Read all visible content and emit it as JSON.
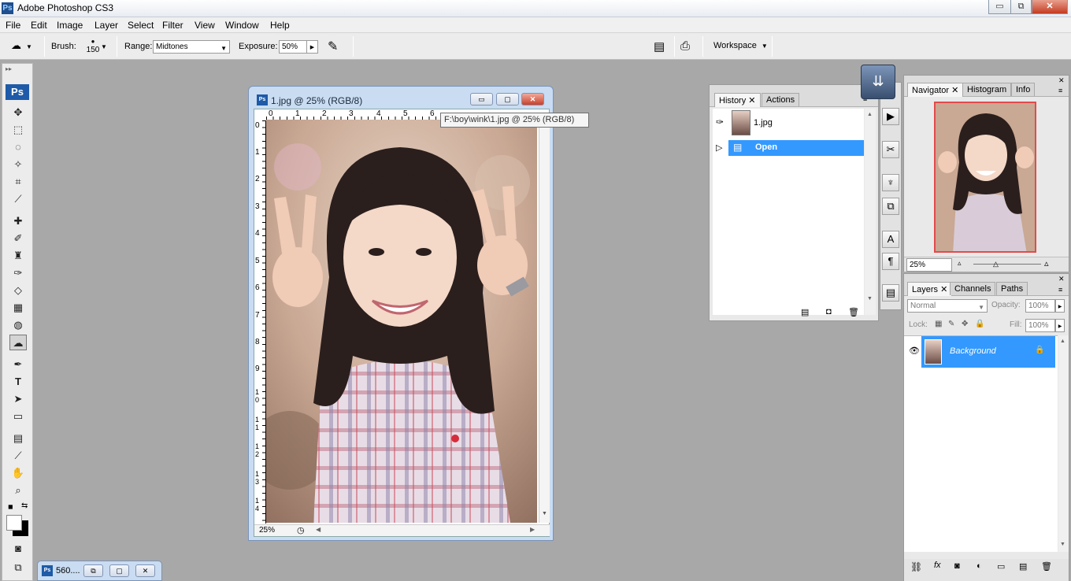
{
  "app": {
    "title": "Adobe Photoshop CS3",
    "badge": "Ps",
    "win_controls": {
      "minimize": "▭",
      "restore": "⧉",
      "close": "✕"
    }
  },
  "menu": [
    "File",
    "Edit",
    "Image",
    "Layer",
    "Select",
    "Filter",
    "View",
    "Window",
    "Help"
  ],
  "options": {
    "brush_label": "Brush:",
    "brush_size": "150",
    "range_label": "Range:",
    "range_value": "Midtones",
    "exposure_label": "Exposure:",
    "exposure_value": "50%",
    "workspace_label": "Workspace"
  },
  "toolbox": {
    "badge": "Ps"
  },
  "document": {
    "title": "1.jpg @ 25% (RGB/8)",
    "tooltip": "F:\\boy\\wink\\1.jpg @ 25% (RGB/8)",
    "zoom": "25%",
    "ruler_top": [
      "0",
      "1",
      "2",
      "3",
      "4",
      "5",
      "6"
    ],
    "ruler_left": [
      "0",
      "1",
      "2",
      "3",
      "4",
      "5",
      "6",
      "7",
      "8",
      "9",
      "1\n0",
      "1\n1",
      "1\n2",
      "1\n3",
      "1\n4"
    ]
  },
  "history_panel": {
    "tabs": [
      "History",
      "Actions"
    ],
    "snapshot": "1.jpg",
    "items": [
      "Open"
    ]
  },
  "navigator_panel": {
    "tabs": [
      "Navigator",
      "Histogram",
      "Info"
    ],
    "zoom": "25%"
  },
  "layers_panel": {
    "tabs": [
      "Layers",
      "Channels",
      "Paths"
    ],
    "blend_mode": "Normal",
    "opacity_label": "Opacity:",
    "opacity_value": "100%",
    "lock_label": "Lock:",
    "fill_label": "Fill:",
    "fill_value": "100%",
    "layer_name": "Background"
  },
  "minimized_doc": {
    "label": "560...."
  },
  "colors": {
    "accent": "#3399ff",
    "doc_frame": "#c9dcf2",
    "workspace": "#a8a8a8"
  }
}
